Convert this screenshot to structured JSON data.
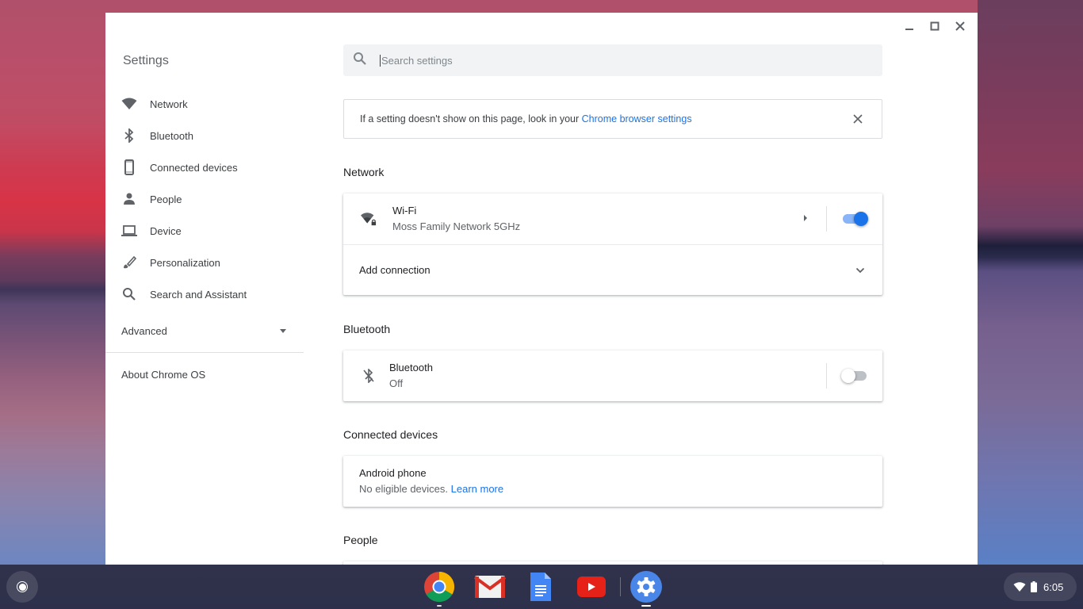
{
  "window": {
    "controls": {
      "minimize": "minimize",
      "maximize": "maximize",
      "close": "close"
    }
  },
  "sidebar": {
    "title": "Settings",
    "items": [
      {
        "label": "Network",
        "icon": "wifi-icon"
      },
      {
        "label": "Bluetooth",
        "icon": "bluetooth-icon"
      },
      {
        "label": "Connected devices",
        "icon": "phone-icon"
      },
      {
        "label": "People",
        "icon": "person-icon"
      },
      {
        "label": "Device",
        "icon": "laptop-icon"
      },
      {
        "label": "Personalization",
        "icon": "brush-icon"
      },
      {
        "label": "Search and Assistant",
        "icon": "search-icon"
      }
    ],
    "advanced_label": "Advanced",
    "about_label": "About Chrome OS"
  },
  "search": {
    "placeholder": "Search settings",
    "value": ""
  },
  "notice": {
    "text": "If a setting doesn't show on this page, look in your ",
    "link": "Chrome browser settings"
  },
  "sections": {
    "network": {
      "heading": "Network",
      "wifi": {
        "title": "Wi-Fi",
        "subtitle": "Moss Family Network 5GHz",
        "enabled": true
      },
      "add_connection": "Add connection"
    },
    "bluetooth": {
      "heading": "Bluetooth",
      "row": {
        "title": "Bluetooth",
        "subtitle": "Off",
        "enabled": false
      }
    },
    "connected_devices": {
      "heading": "Connected devices",
      "android": {
        "title": "Android phone",
        "subtitle": "No eligible devices.",
        "link": "Learn more"
      }
    },
    "people": {
      "heading": "People"
    }
  },
  "shelf": {
    "apps": [
      {
        "name": "Chrome",
        "icon": "chrome-icon",
        "running": true,
        "active": false
      },
      {
        "name": "Gmail",
        "icon": "gmail-icon",
        "running": false,
        "active": false
      },
      {
        "name": "Docs",
        "icon": "docs-icon",
        "running": false,
        "active": false
      },
      {
        "name": "YouTube",
        "icon": "youtube-icon",
        "running": false,
        "active": false
      },
      {
        "name": "Settings",
        "icon": "settings-gear-icon",
        "running": true,
        "active": true
      }
    ],
    "tray": {
      "time": "6:05"
    }
  },
  "colors": {
    "accent": "#1a73e8",
    "toggle_track_on": "#8ab4f8"
  }
}
